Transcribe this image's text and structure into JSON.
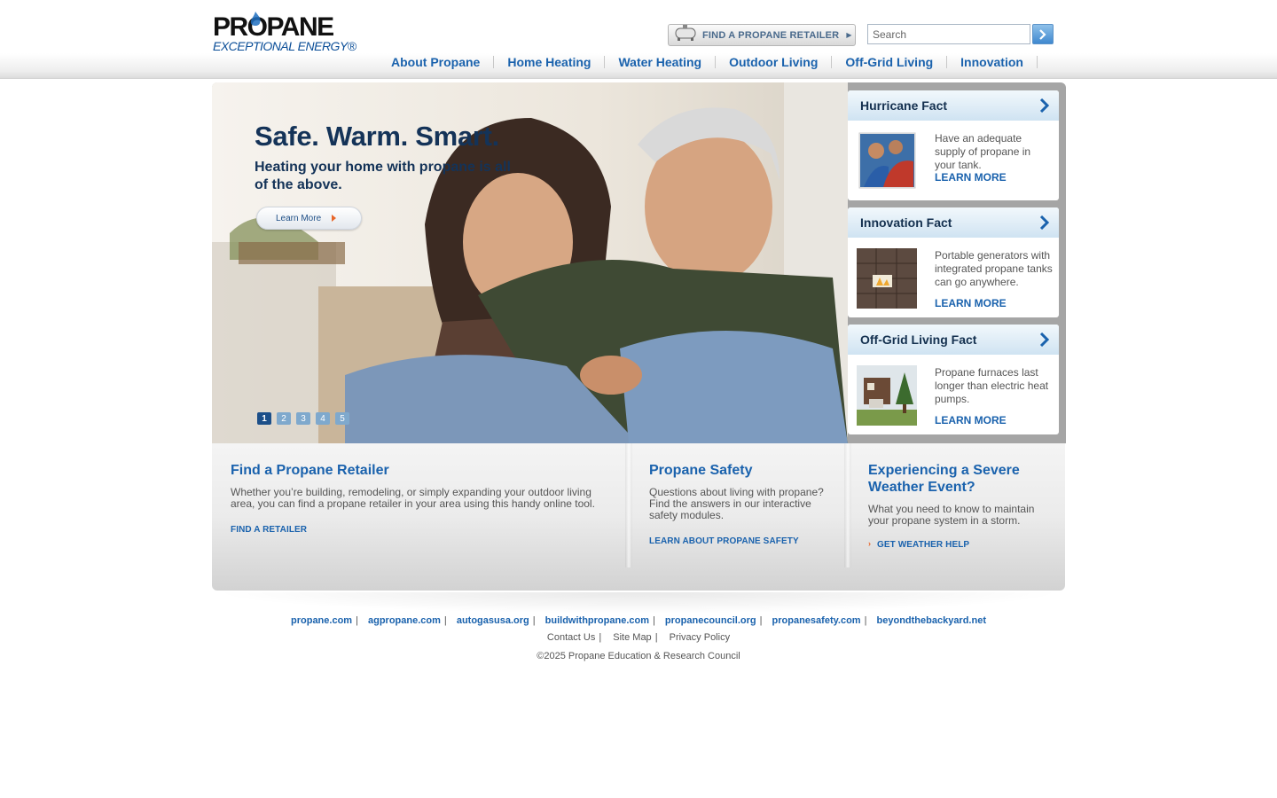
{
  "logo": {
    "main": "PROPANE",
    "tagline": "EXCEPTIONAL ENERGY®"
  },
  "header": {
    "retailer_button": "FIND A PROPANE RETAILER",
    "search_placeholder": "Search"
  },
  "nav": [
    "About Propane",
    "Home Heating",
    "Water Heating",
    "Outdoor Living",
    "Off-Grid Living",
    "Innovation"
  ],
  "hero": {
    "title": "Safe. Warm. Smart.",
    "subtitle": "Heating your home with propane is all of the above.",
    "button": "Learn More",
    "pages": [
      "1",
      "2",
      "3",
      "4",
      "5"
    ],
    "active_page": 1
  },
  "facts": [
    {
      "title": "Hurricane Fact",
      "text": "Have an adequate supply of propane in your tank.",
      "link": "LEARN MORE",
      "thumb": "family-image"
    },
    {
      "title": "Innovation Fact",
      "text": "Portable generators with integrated propane tanks can go anywhere.",
      "link": "LEARN MORE",
      "thumb": "fireplace-image"
    },
    {
      "title": "Off-Grid Living Fact",
      "text": "Propane furnaces last longer than electric heat pumps.",
      "link": "LEARN MORE",
      "thumb": "cabin-image"
    }
  ],
  "panels": [
    {
      "title": "Find a Propane Retailer",
      "text": "Whether you’re building, remodeling, or simply expanding your outdoor living area, you can find a propane retailer in your area using this handy online tool.",
      "link": "FIND A RETAILER"
    },
    {
      "title": "Propane Safety",
      "text": "Questions about living with propane? Find the answers in our interactive safety modules.",
      "link": "LEARN ABOUT PROPANE SAFETY"
    },
    {
      "title": "Experiencing a Severe Weather Event?",
      "text": "What you need to know to maintain your propane system in a storm.",
      "link": "GET WEATHER HELP"
    }
  ],
  "footer": {
    "sites": [
      "propane.com",
      "agpropane.com",
      "autogasusa.org",
      "buildwithpropane.com",
      "propanecouncil.org",
      "propanesafety.com",
      "beyondthebackyard.net"
    ],
    "utility": [
      "Contact Us",
      "Site Map",
      "Privacy Policy"
    ],
    "copyright": "©2025 Propane Education & Research Council"
  },
  "colors": {
    "brand_blue": "#1a62ad",
    "navy": "#143358",
    "accent_orange": "#e8662a"
  }
}
